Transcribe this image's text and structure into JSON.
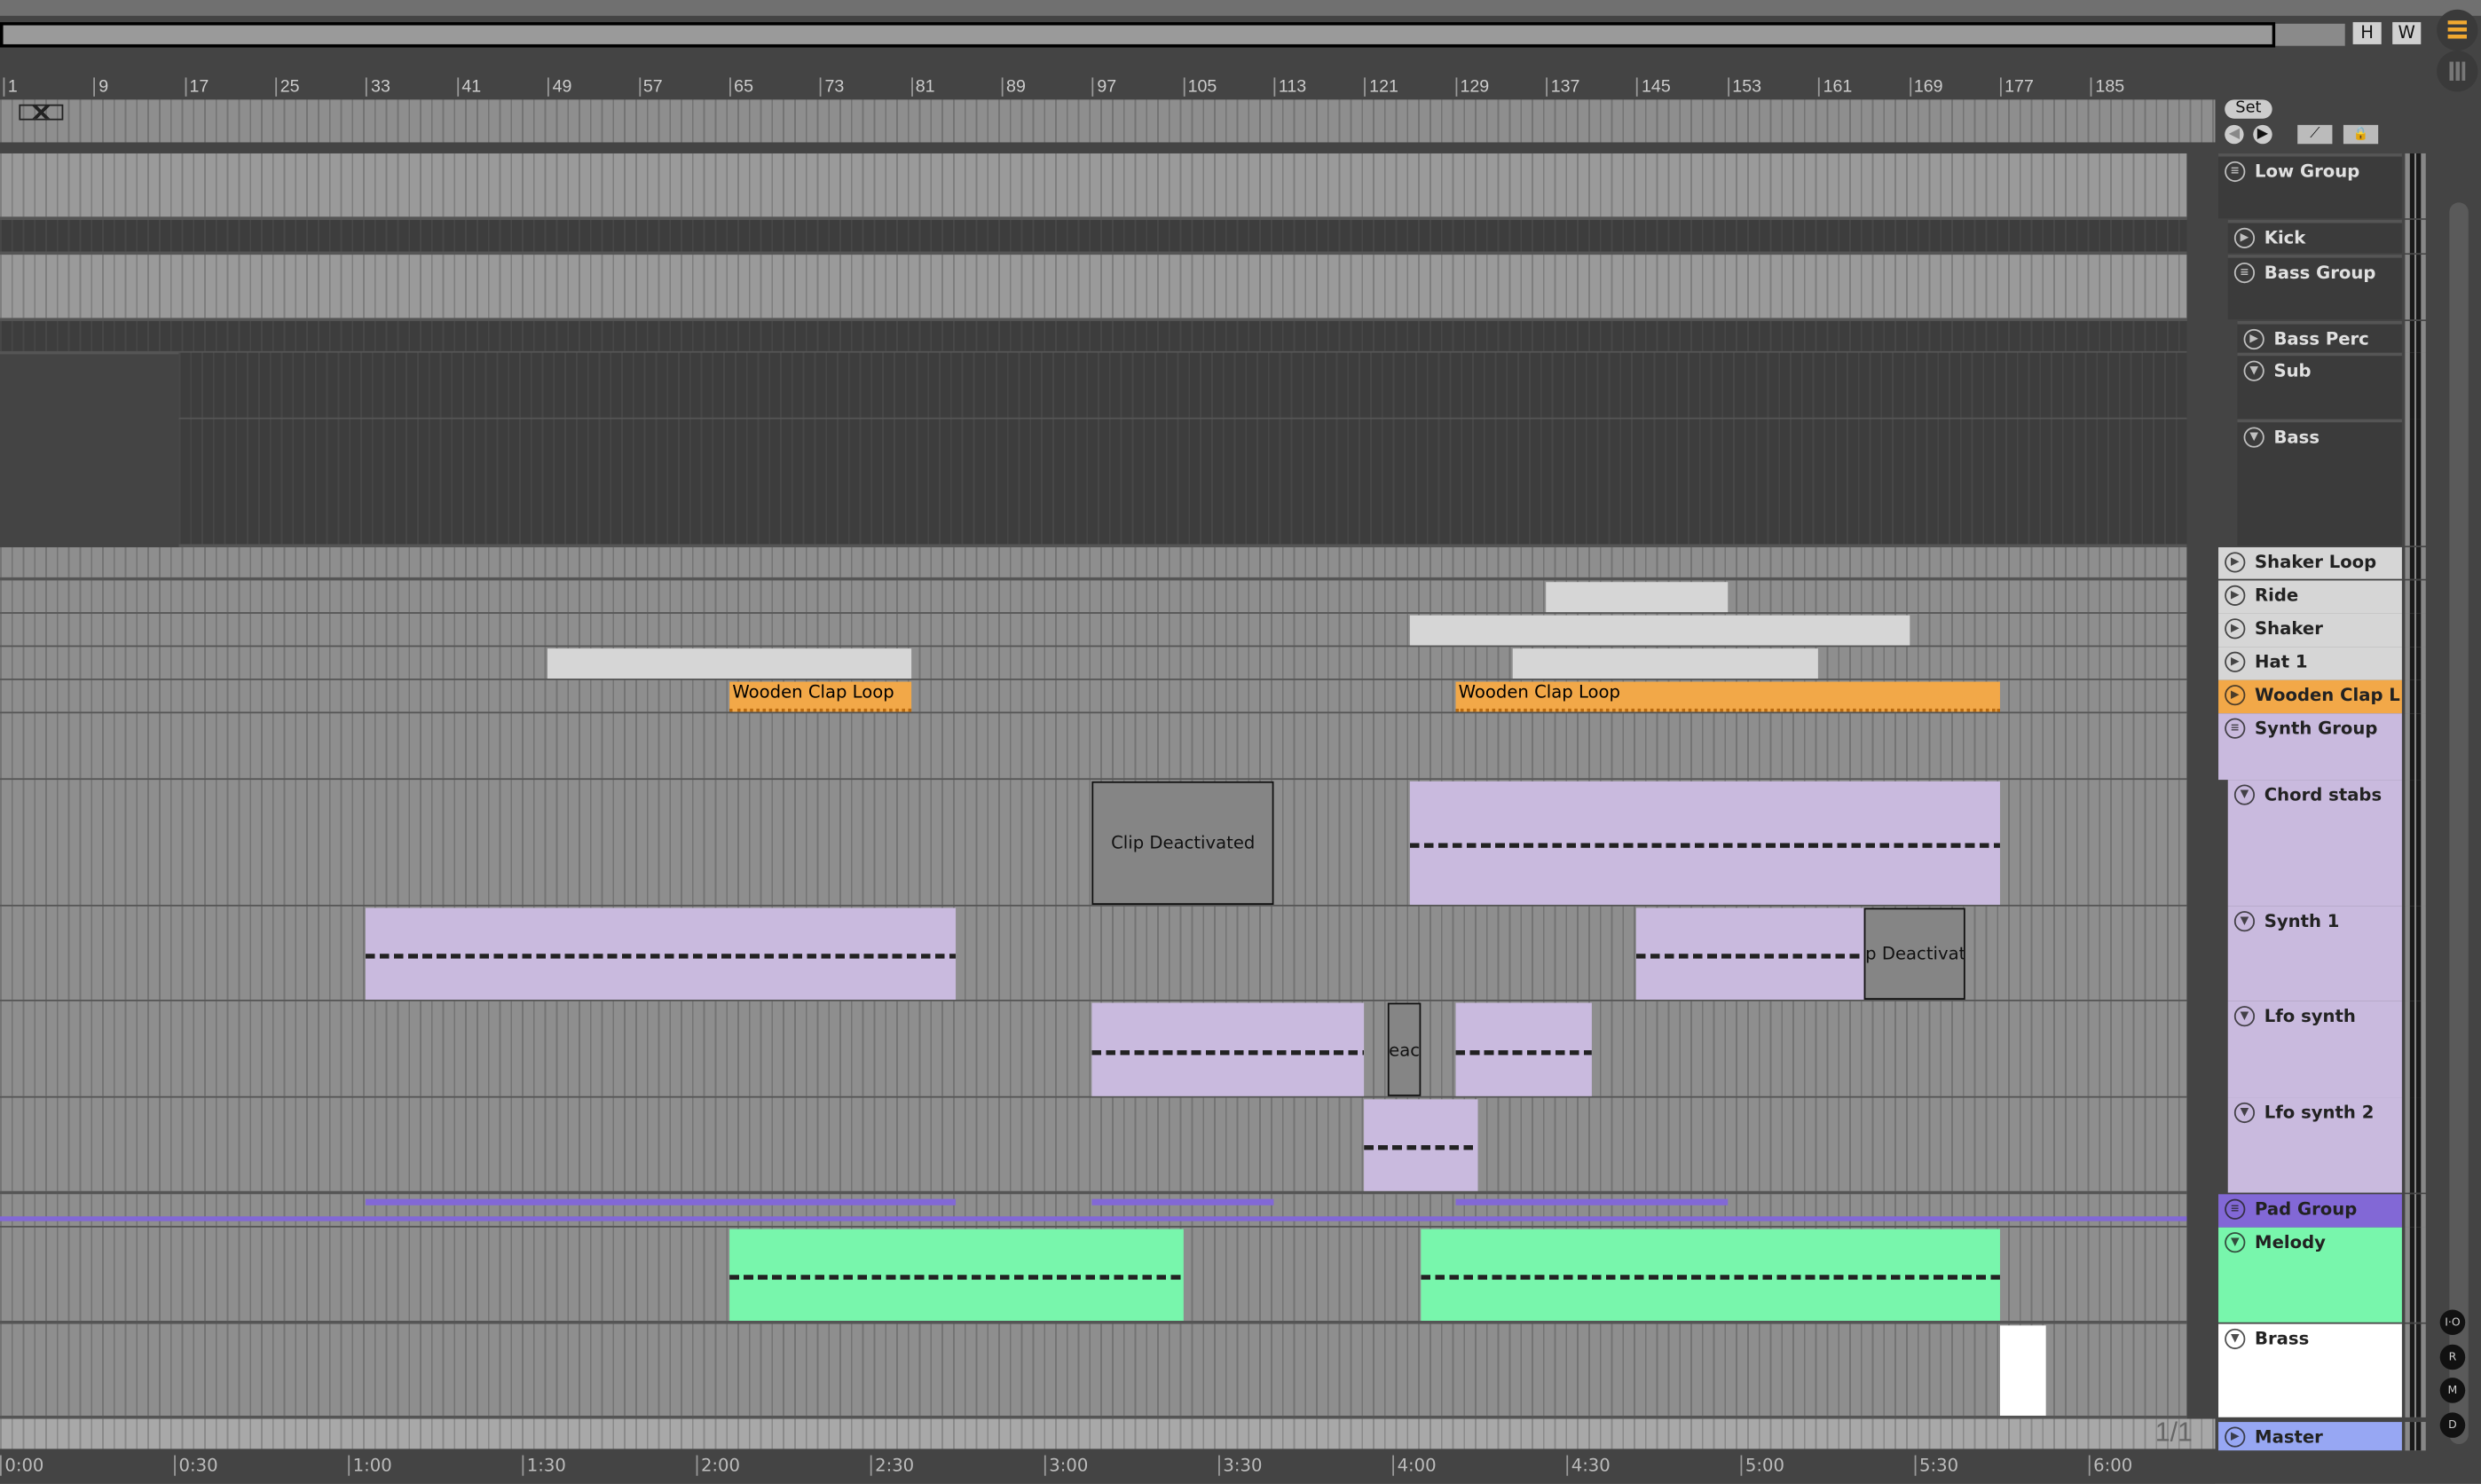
{
  "overview": {
    "h_label": "H",
    "w_label": "W"
  },
  "ruler": {
    "bars": [
      "1",
      "9",
      "17",
      "25",
      "33",
      "41",
      "49",
      "57",
      "65",
      "73",
      "81",
      "89",
      "97",
      "105",
      "113",
      "121",
      "129",
      "137",
      "145",
      "153",
      "161",
      "169",
      "177",
      "185"
    ]
  },
  "time_ruler": {
    "labels": [
      "0:00",
      "0:30",
      "1:00",
      "1:30",
      "2:00",
      "2:30",
      "3:00",
      "3:30",
      "4:00",
      "4:30",
      "5:00",
      "5:30",
      "6:00"
    ]
  },
  "set_panel": {
    "set_label": "Set"
  },
  "zoom_indicator": "1/1",
  "side_buttons": [
    "I·O",
    "R",
    "M",
    "D"
  ],
  "colors": {
    "light": "#d6d6d6",
    "orange": "#f2a848",
    "lavender": "#c9bade",
    "pad": "#8268d6",
    "melody": "#78f6ac",
    "brass": "#ffffff",
    "master": "#97a7f3",
    "dark": "#3b3b3b"
  },
  "tracks": [
    {
      "name": "Low Group",
      "icon": "group",
      "color": "dark"
    },
    {
      "name": "Kick",
      "icon": "play",
      "color": "dark"
    },
    {
      "name": "Bass Group",
      "icon": "group",
      "color": "dark"
    },
    {
      "name": "Bass Perc",
      "icon": "play",
      "color": "dark"
    },
    {
      "name": "Sub",
      "icon": "fold",
      "color": "dark"
    },
    {
      "name": "Bass",
      "icon": "fold",
      "color": "dark"
    },
    {
      "name": "Shaker Loop",
      "icon": "play",
      "color": "light"
    },
    {
      "name": "Ride",
      "icon": "play",
      "color": "light"
    },
    {
      "name": "Shaker",
      "icon": "play",
      "color": "light"
    },
    {
      "name": "Hat 1",
      "icon": "play",
      "color": "light"
    },
    {
      "name": "Wooden Clap L",
      "icon": "play",
      "color": "orange"
    },
    {
      "name": "Synth Group",
      "icon": "group",
      "color": "lavender"
    },
    {
      "name": "Chord stabs",
      "icon": "fold",
      "color": "lavender"
    },
    {
      "name": "Synth 1",
      "icon": "fold",
      "color": "lavender"
    },
    {
      "name": "Lfo synth",
      "icon": "fold",
      "color": "lavender"
    },
    {
      "name": "Lfo synth 2",
      "icon": "fold",
      "color": "lavender"
    },
    {
      "name": "Pad Group",
      "icon": "group",
      "color": "pad"
    },
    {
      "name": "Melody",
      "icon": "fold",
      "color": "melody"
    },
    {
      "name": "Brass",
      "icon": "fold",
      "color": "brass"
    },
    {
      "name": "Master",
      "icon": "play",
      "color": "master"
    }
  ],
  "clips": [
    {
      "track": 7,
      "start": 137,
      "end": 153,
      "color": "light"
    },
    {
      "track": 8,
      "start": 125,
      "end": 169,
      "color": "light"
    },
    {
      "track": 9,
      "start": 49,
      "end": 81,
      "color": "light"
    },
    {
      "track": 9,
      "start": 134,
      "end": 161,
      "color": "light"
    },
    {
      "track": 10,
      "start": 65,
      "end": 81,
      "color": "orange",
      "label": "Wooden Clap Loop"
    },
    {
      "track": 10,
      "start": 129,
      "end": 177,
      "color": "orange",
      "label": "Wooden Clap Loop"
    },
    {
      "track": 12,
      "start": 97,
      "end": 113,
      "deactivated": true,
      "label": "Clip Deactivated"
    },
    {
      "track": 12,
      "start": 125,
      "end": 177,
      "color": "lavender",
      "notes": true
    },
    {
      "track": 13,
      "start": 33,
      "end": 85,
      "color": "lavender",
      "notes": true
    },
    {
      "track": 13,
      "start": 145,
      "end": 165,
      "color": "lavender",
      "notes": true
    },
    {
      "track": 13,
      "start": 165,
      "end": 174,
      "deactivated": true,
      "label": "p Deactivat"
    },
    {
      "track": 14,
      "start": 97,
      "end": 121,
      "color": "lavender",
      "notes": true
    },
    {
      "track": 14,
      "start": 123,
      "end": 126,
      "deactivated": true,
      "label": "eact"
    },
    {
      "track": 14,
      "start": 129,
      "end": 141,
      "color": "lavender",
      "notes": true
    },
    {
      "track": 15,
      "start": 121,
      "end": 131,
      "color": "lavender",
      "notes": true
    },
    {
      "track": 17,
      "start": 65,
      "end": 105,
      "color": "melody",
      "notes": true
    },
    {
      "track": 17,
      "start": 126,
      "end": 177,
      "color": "melody",
      "notes": true
    },
    {
      "track": 18,
      "start": 177,
      "end": 181,
      "color": "brass"
    }
  ]
}
